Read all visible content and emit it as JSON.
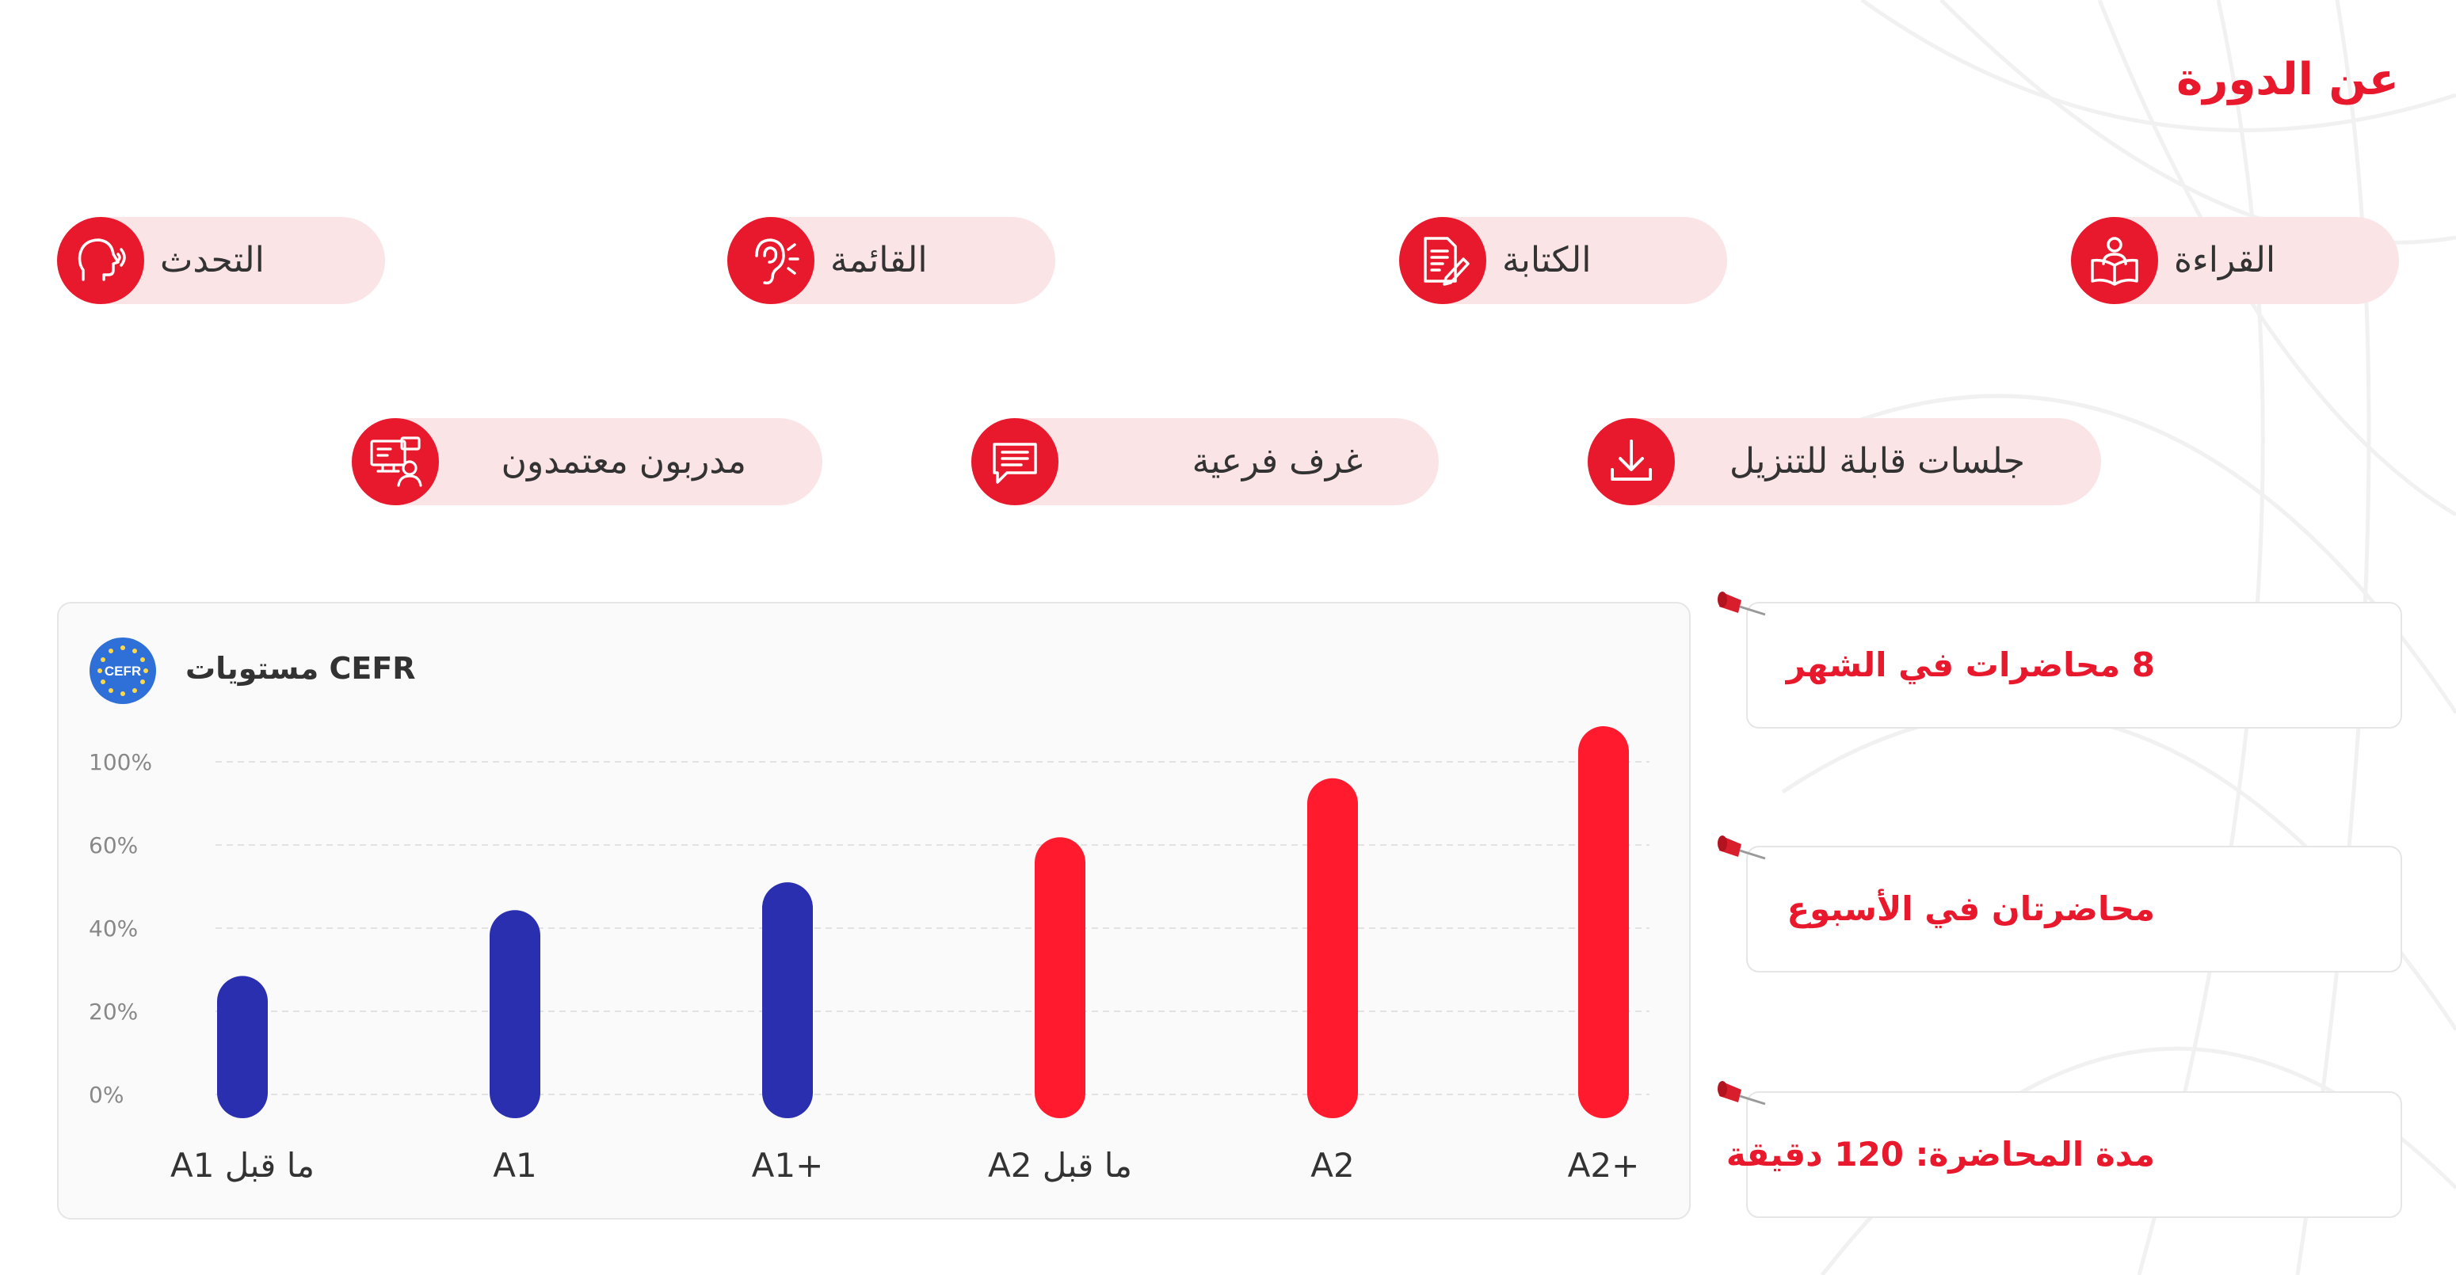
{
  "header": {
    "title": "عن الدورة"
  },
  "skills": [
    {
      "label": "التحدث",
      "icon": "speaking-head-icon"
    },
    {
      "label": "القائمة",
      "icon": "ear-listening-icon"
    },
    {
      "label": "الكتابة",
      "icon": "document-pen-icon"
    },
    {
      "label": "القراءة",
      "icon": "reading-book-icon"
    }
  ],
  "features": [
    {
      "label": "مدربون معتمدون",
      "icon": "certified-trainer-icon"
    },
    {
      "label": "غرف فرعية",
      "icon": "chat-bubble-icon"
    },
    {
      "label": "جلسات قابلة للتنزيل",
      "icon": "download-icon"
    }
  ],
  "info": [
    {
      "text": "8 محاضرات في الشهر"
    },
    {
      "text": "محاضرتان في الأسبوع"
    },
    {
      "text": "مدة المحاضرة: 120 دقيقة"
    }
  ],
  "chart_data": {
    "type": "bar",
    "title": "مستويات CEFR",
    "logo_text": "CEFR",
    "categories": [
      "ما قبل A1",
      "A1",
      "A1+",
      "ما قبل A2",
      "A2",
      "A2+"
    ],
    "values": [
      41,
      60,
      68,
      81,
      98,
      113
    ],
    "bar_colors": [
      "#2a2fb0",
      "#2a2fb0",
      "#2a2fb0",
      "#ff1a2d",
      "#ff1a2d",
      "#ff1a2d"
    ],
    "y_ticks": [
      "0%",
      "20%",
      "40%",
      "60%",
      "100%"
    ],
    "grid": true
  },
  "colors": {
    "accent": "#e8192c",
    "blue": "#2a2fb0",
    "red": "#ff1a2d",
    "pill_bg": "#fbe4e6"
  }
}
